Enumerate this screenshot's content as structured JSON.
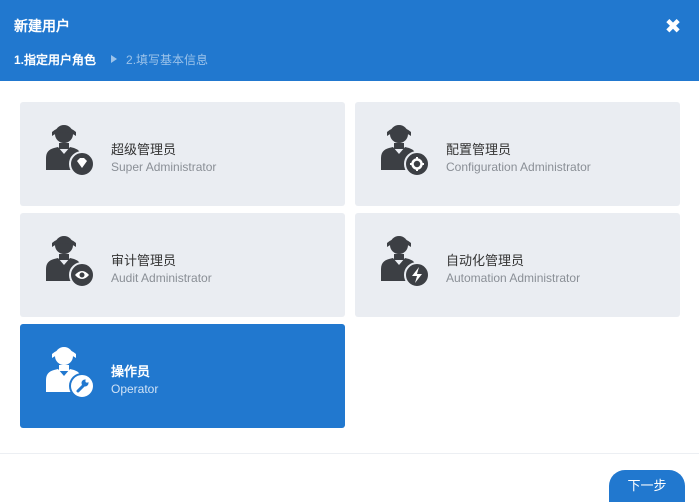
{
  "dialog": {
    "title": "新建用户",
    "close_glyph": "✖",
    "steps": [
      {
        "label": "1.指定用户角色",
        "active": true
      },
      {
        "label": "2.填写基本信息",
        "active": false
      }
    ]
  },
  "roles": [
    {
      "name": "超级管理员",
      "en": "Super Administrator",
      "badge_icon": "diamond-icon",
      "selected": false
    },
    {
      "name": "配置管理员",
      "en": "Configuration Administrator",
      "badge_icon": "gear-icon",
      "selected": false
    },
    {
      "name": "审计管理员",
      "en": "Audit Administrator",
      "badge_icon": "eye-icon",
      "selected": false
    },
    {
      "name": "自动化管理员",
      "en": "Automation Administrator",
      "badge_icon": "lightning-icon",
      "selected": false
    },
    {
      "name": "操作员",
      "en": "Operator",
      "badge_icon": "wrench-icon",
      "selected": true
    }
  ],
  "footer": {
    "next_label": "下一步"
  },
  "colors": {
    "primary": "#2178cf",
    "card_bg": "#eaedf2",
    "avatar_dark": "#3c3f44"
  }
}
